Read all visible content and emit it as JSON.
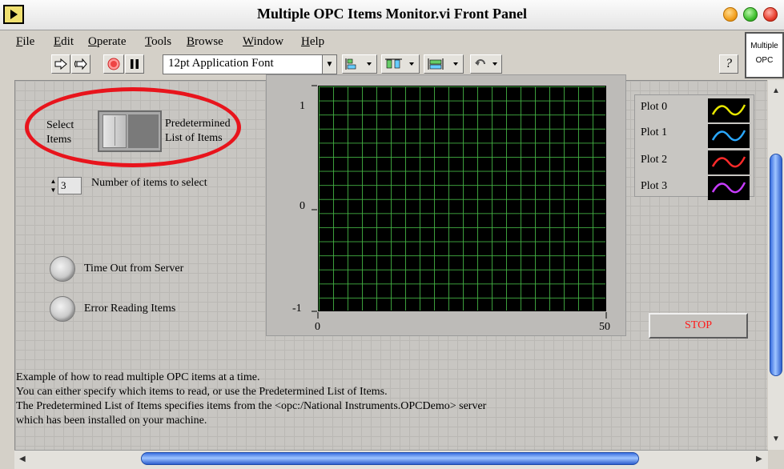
{
  "window": {
    "title": "Multiple OPC Items Monitor.vi Front Panel"
  },
  "menu": [
    {
      "label": "File",
      "ul": "F",
      "rest": "ile"
    },
    {
      "label": "Edit",
      "ul": "E",
      "rest": "dit"
    },
    {
      "label": "Operate",
      "ul": "O",
      "rest": "perate"
    },
    {
      "label": "Tools",
      "ul": "T",
      "rest": "ools"
    },
    {
      "label": "Browse",
      "ul": "B",
      "rest": "rowse"
    },
    {
      "label": "Window",
      "ul": "W",
      "rest": "indow"
    },
    {
      "label": "Help",
      "ul": "H",
      "rest": "elp"
    }
  ],
  "toolbar": {
    "font": "12pt Application Font",
    "help": "?"
  },
  "minipanel": {
    "line1": "Multiple",
    "line2": "OPC"
  },
  "switch": {
    "left_label": [
      "Select",
      "Items"
    ],
    "right_label": [
      "Predetermined",
      "List of Items"
    ]
  },
  "number_control": {
    "value": "3",
    "label": "Number of items to select"
  },
  "indicators": {
    "timeout": "Time Out from Server",
    "error": "Error Reading Items"
  },
  "graph": {
    "y_ticks": [
      "1",
      "0",
      "-1"
    ],
    "x_ticks": [
      "0",
      "50"
    ],
    "legend": [
      {
        "name": "Plot 0",
        "color": "#e8e800"
      },
      {
        "name": "Plot 1",
        "color": "#2aa8ff"
      },
      {
        "name": "Plot 2",
        "color": "#ff2a2a"
      },
      {
        "name": "Plot 3",
        "color": "#c83cff"
      }
    ]
  },
  "stop_button": {
    "label": "STOP"
  },
  "description": [
    "Example of how to read multiple OPC items at a time.",
    "You can either specify which items to read, or use the Predetermined List of Items.",
    "The Predetermined List of Items specifies items from the <opc:/National Instruments.OPCDemo> server",
    "which has been installed on your machine."
  ],
  "colors": {
    "accent_highlight": "#e8141c",
    "grid_green": "#46b946",
    "stop_text": "#ff1a1a"
  }
}
